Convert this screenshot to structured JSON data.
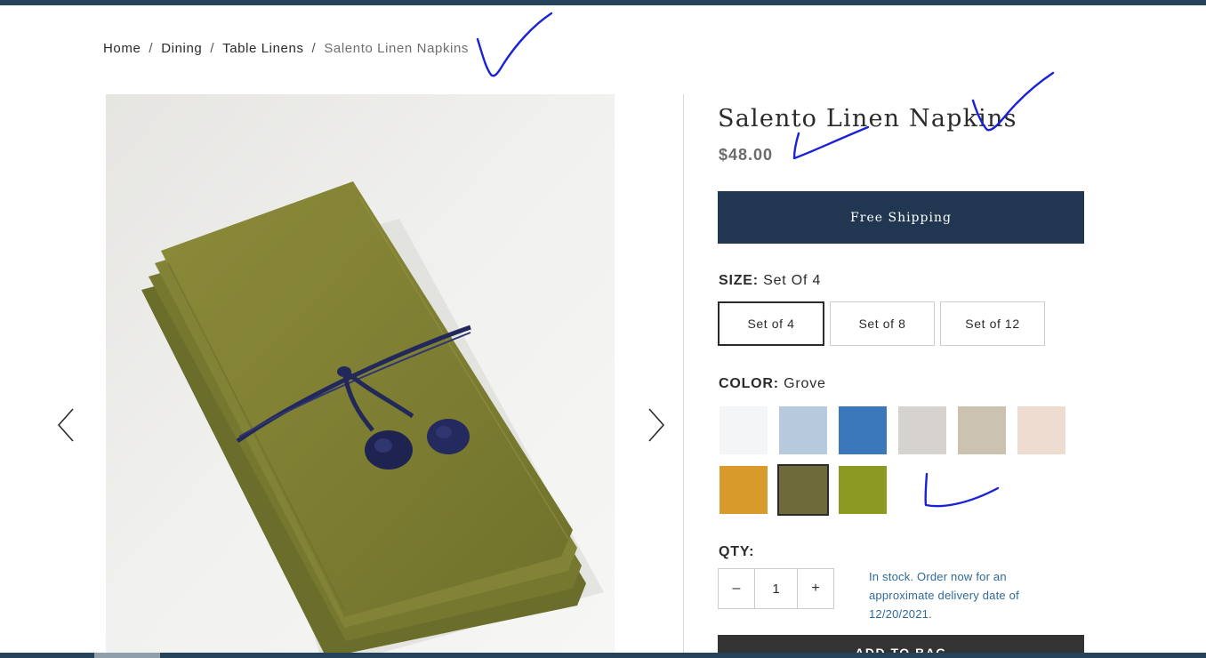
{
  "breadcrumb": {
    "items": [
      "Home",
      "Dining",
      "Table Linens"
    ],
    "current": "Salento Linen Napkins",
    "separator": "/"
  },
  "product": {
    "title": "Salento Linen Napkins",
    "price": "$48.00",
    "shipping_banner": "Free Shipping"
  },
  "size": {
    "label": "SIZE:",
    "selected_value": "Set Of 4",
    "options": [
      "Set of 4",
      "Set of 8",
      "Set of 12"
    ]
  },
  "color": {
    "label": "COLOR:",
    "selected_value": "Grove",
    "swatches": [
      "#f4f5f7",
      "#b7c9dd",
      "#3a77bb",
      "#d6d2cd",
      "#cbc2b2",
      "#efdcd0",
      "#d99a2c",
      "#6f6a3a",
      "#8c9a24"
    ]
  },
  "quantity": {
    "label": "QTY:",
    "decrement": "–",
    "value": "1",
    "increment": "+"
  },
  "stock_message": "In stock. Order now for an approximate delivery date of 12/20/2021.",
  "add_to_bag": "ADD TO BAG",
  "colors": {
    "brand_navy": "#213651",
    "stock_text": "#2f6a9a",
    "annotation": "#1a22d8"
  }
}
